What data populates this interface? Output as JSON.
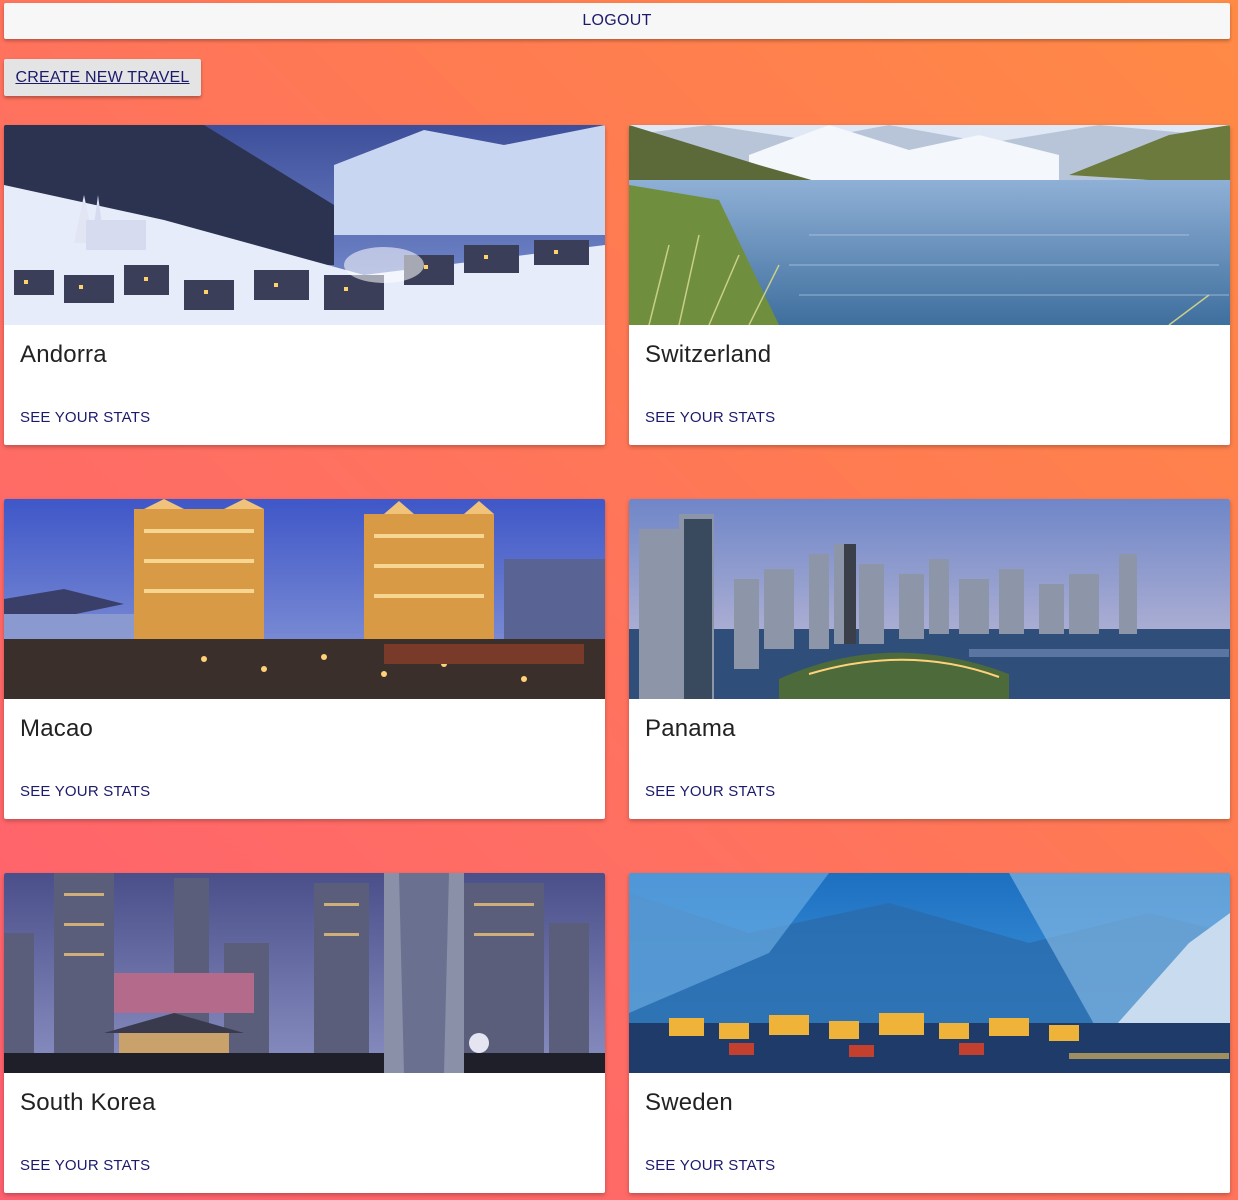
{
  "header": {
    "logout_label": "LOGOUT",
    "create_label": "CREATE NEW TRAVEL"
  },
  "cards": [
    {
      "title": "Andorra",
      "link": "SEE YOUR STATS",
      "image": "snowy mountain village at dusk"
    },
    {
      "title": "Switzerland",
      "link": "SEE YOUR STATS",
      "image": "alpine lake with snowy peaks"
    },
    {
      "title": "Macao",
      "link": "SEE YOUR STATS",
      "image": "illuminated casino towers at night"
    },
    {
      "title": "Panama",
      "link": "SEE YOUR STATS",
      "image": "city skyline by the bay"
    },
    {
      "title": "South Korea",
      "link": "SEE YOUR STATS",
      "image": "night city skyline with statue"
    },
    {
      "title": "Sweden",
      "link": "SEE YOUR STATS",
      "image": "fjord village below blue mountains"
    }
  ],
  "colors": {
    "link_text": "#1c1a6b",
    "background_start": "#ff8a45",
    "background_end": "#ff5f6f"
  }
}
